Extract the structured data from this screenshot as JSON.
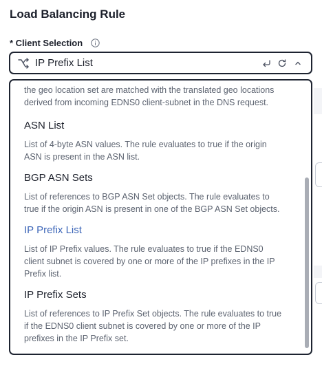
{
  "page": {
    "title": "Load Balancing Rule"
  },
  "field": {
    "label": "* Client Selection",
    "info_icon": "info-icon",
    "value": "IP Prefix List",
    "lead_icon": "merge-branch-icon",
    "actions": [
      "undo-icon",
      "refresh-icon",
      "chevron-up-icon"
    ]
  },
  "dropdown": {
    "truncated_text": "the geo location set are matched with the translated geo locations derived from incoming EDNS0 client-subnet in the DNS request.",
    "options": [
      {
        "name": "ASN List",
        "description": "List of 4-byte ASN values. The rule evaluates to true if the origin ASN is present in the ASN list.",
        "selected": false
      },
      {
        "name": "BGP ASN Sets",
        "description": "List of references to BGP ASN Set objects. The rule evaluates to true if the origin ASN is present in one of the BGP ASN Set objects.",
        "selected": false
      },
      {
        "name": "IP Prefix List",
        "description": "List of IP Prefix values. The rule evaluates to true if the EDNS0 client subnet is covered by one or more of the IP prefixes in the IP Prefix list.",
        "selected": true
      },
      {
        "name": "IP Prefix Sets",
        "description": "List of references to IP Prefix Set objects. The rule evaluates to true if the EDNS0 client subnet is covered by one or more of the IP prefixes in the IP Prefix set.",
        "selected": false
      }
    ]
  },
  "colors": {
    "selected_option": "#3d66b8",
    "border": "#1d2330",
    "muted_text": "#5c6370",
    "scrollbar": "#a9adb5"
  }
}
